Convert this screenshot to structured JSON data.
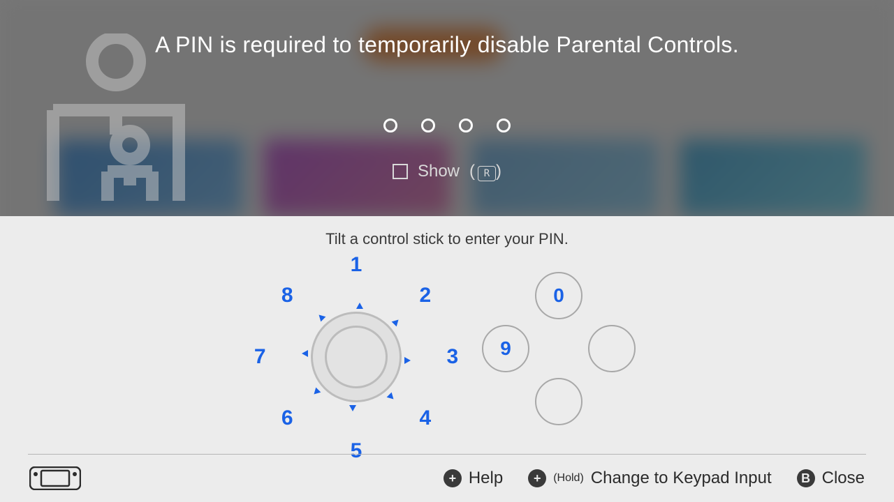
{
  "title": "A PIN is required to temporarily disable Parental Controls.",
  "pin_length": 4,
  "show": {
    "label": "Show",
    "button_glyph": "R"
  },
  "instruction": "Tilt a control stick to enter your PIN.",
  "dial": {
    "n1": "1",
    "n2": "2",
    "n3": "3",
    "n4": "4",
    "n5": "5",
    "n6": "6",
    "n7": "7",
    "n8": "8"
  },
  "cluster": {
    "top": "0",
    "left": "9",
    "right": "",
    "bottom": ""
  },
  "footer": {
    "help_glyph": "+",
    "help_label": "Help",
    "change_glyph": "+",
    "change_prefix": "(Hold)",
    "change_label": "Change to Keypad Input",
    "close_glyph": "B",
    "close_label": "Close"
  }
}
